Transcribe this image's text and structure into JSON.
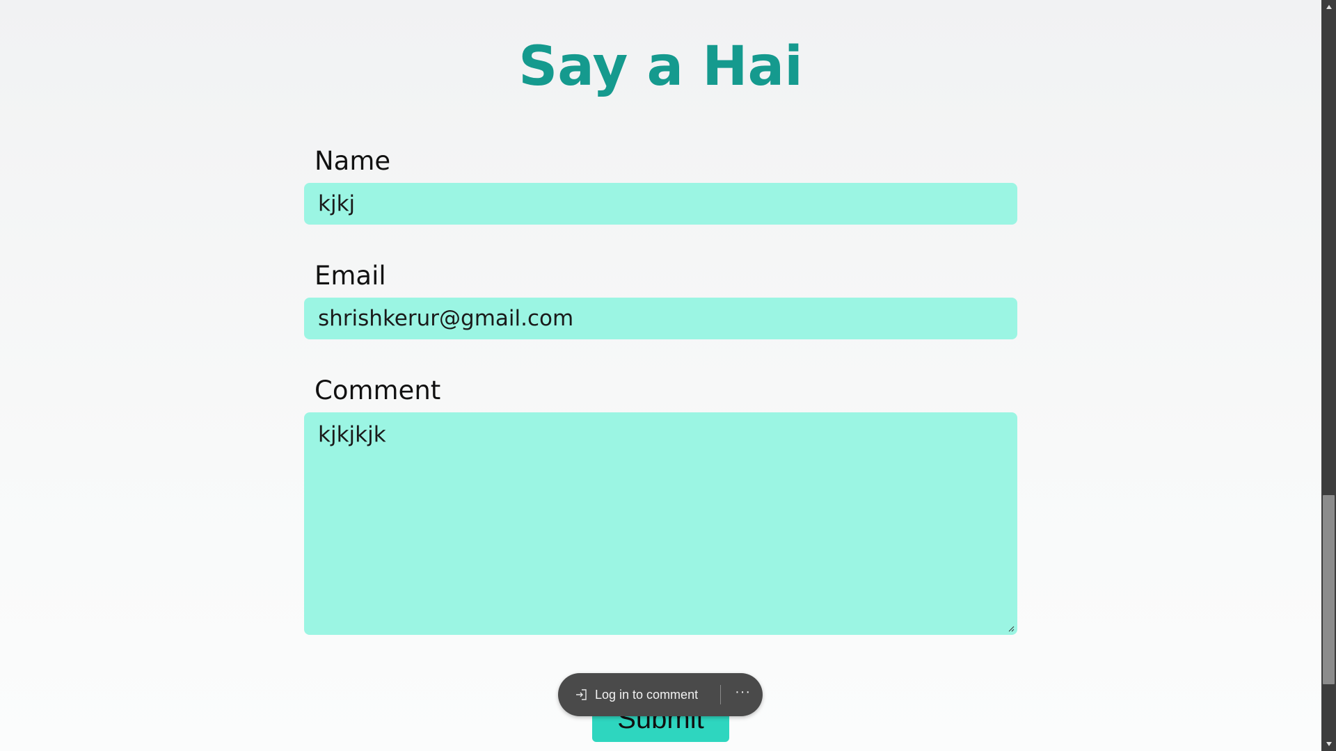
{
  "form": {
    "title": "Say a Hai",
    "name_label": "Name",
    "name_value": "kjkj",
    "email_label": "Email",
    "email_value": "shrishkerur@gmail.com",
    "comment_label": "Comment",
    "comment_value": "kjkjkjk",
    "submit_label": "Submit"
  },
  "toast": {
    "login_label": "Log in to comment",
    "more_label": "···"
  },
  "colors": {
    "title": "#159a8e",
    "field_bg": "#9bf5e3",
    "submit_bg": "#2ed6bf",
    "toast_bg": "#4a4a4a"
  },
  "icons": {
    "login": "login-arrow-icon",
    "more": "more-options-icon",
    "scroll_up": "scroll-up-arrow-icon",
    "scroll_down": "scroll-down-arrow-icon",
    "resize": "resize-grip-icon"
  }
}
